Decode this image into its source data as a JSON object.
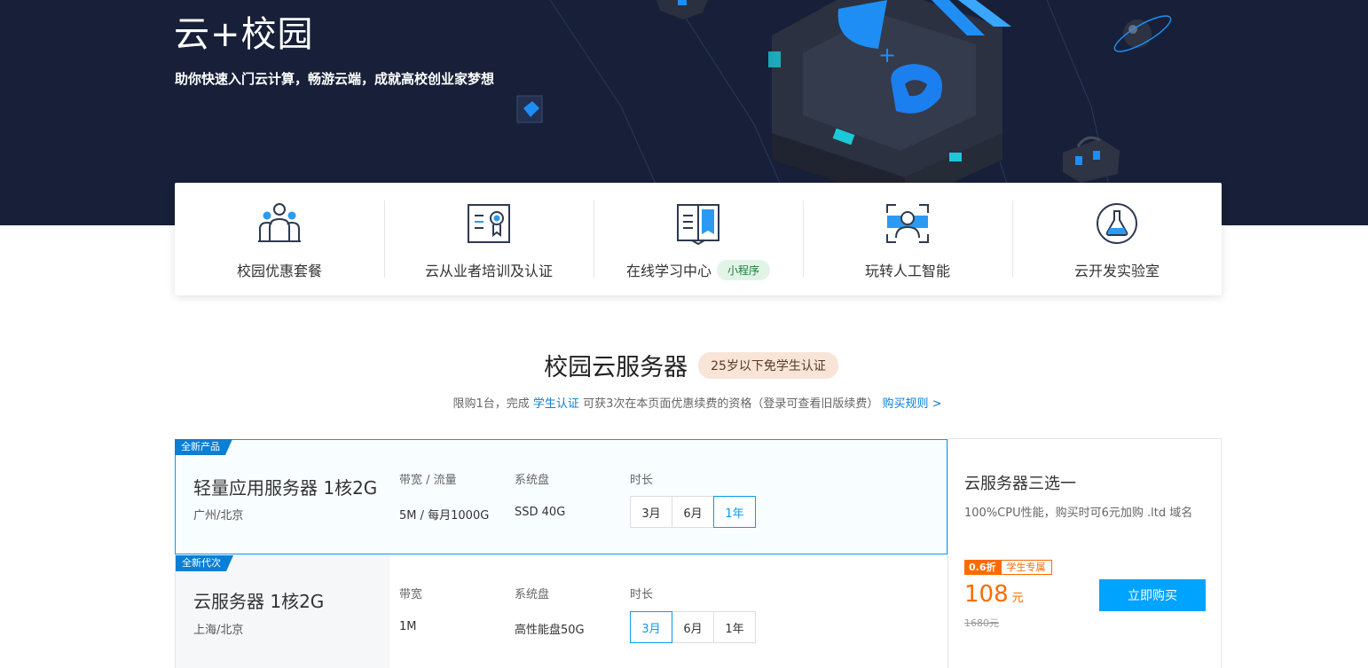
{
  "hero": {
    "title": "云+校园",
    "subtitle": "助你快速入门云计算，畅游云端，成就高校创业家梦想"
  },
  "nav": {
    "items": [
      {
        "label": "校园优惠套餐",
        "icon": "people-group-icon"
      },
      {
        "label": "云从业者培训及认证",
        "icon": "certificate-icon"
      },
      {
        "label": "在线学习中心",
        "icon": "open-book-icon",
        "badge": "小程序"
      },
      {
        "label": "玩转人工智能",
        "icon": "face-scan-icon"
      },
      {
        "label": "云开发实验室",
        "icon": "flask-icon"
      }
    ]
  },
  "section": {
    "title": "校园云服务器",
    "pill": "25岁以下免学生认证",
    "note_prefix": "限购1台，完成",
    "note_link": "学生认证",
    "note_middle": "可获3次在本页面优惠续费的资格（登录可查看旧版续费）",
    "rules_link": "购买规则 >"
  },
  "products": [
    {
      "tag": "全新产品",
      "name": "轻量应用服务器 1核2G",
      "region": "广州/北京",
      "bandwidth_label": "带宽 / 流量",
      "bandwidth_value": "5M / 每月1000G",
      "disk_label": "系统盘",
      "disk_value": "SSD 40G",
      "duration_label": "时长",
      "durations": [
        "3月",
        "6月",
        "1年"
      ],
      "selected_duration": "1年"
    },
    {
      "tag": "全新代次",
      "name": "云服务器 1核2G",
      "region": "上海/北京",
      "bandwidth_label": "带宽",
      "bandwidth_value": "1M",
      "disk_label": "系统盘",
      "disk_value": "高性能盘50G",
      "duration_label": "时长",
      "durations": [
        "3月",
        "6月",
        "1年"
      ],
      "selected_duration": "3月"
    }
  ],
  "summary": {
    "title": "云服务器三选一",
    "desc": "100%CPU性能，购买时可6元加购 .ltd 域名",
    "discount": "0.6折",
    "student_tag": "学生专属",
    "price": "108",
    "price_unit": "元",
    "original_price": "1680元",
    "buy_label": "立即购买"
  },
  "colors": {
    "hero_bg": "#172038",
    "accent": "#0a9af0",
    "buy_button": "#00a4ff",
    "price": "#ff6a00"
  }
}
